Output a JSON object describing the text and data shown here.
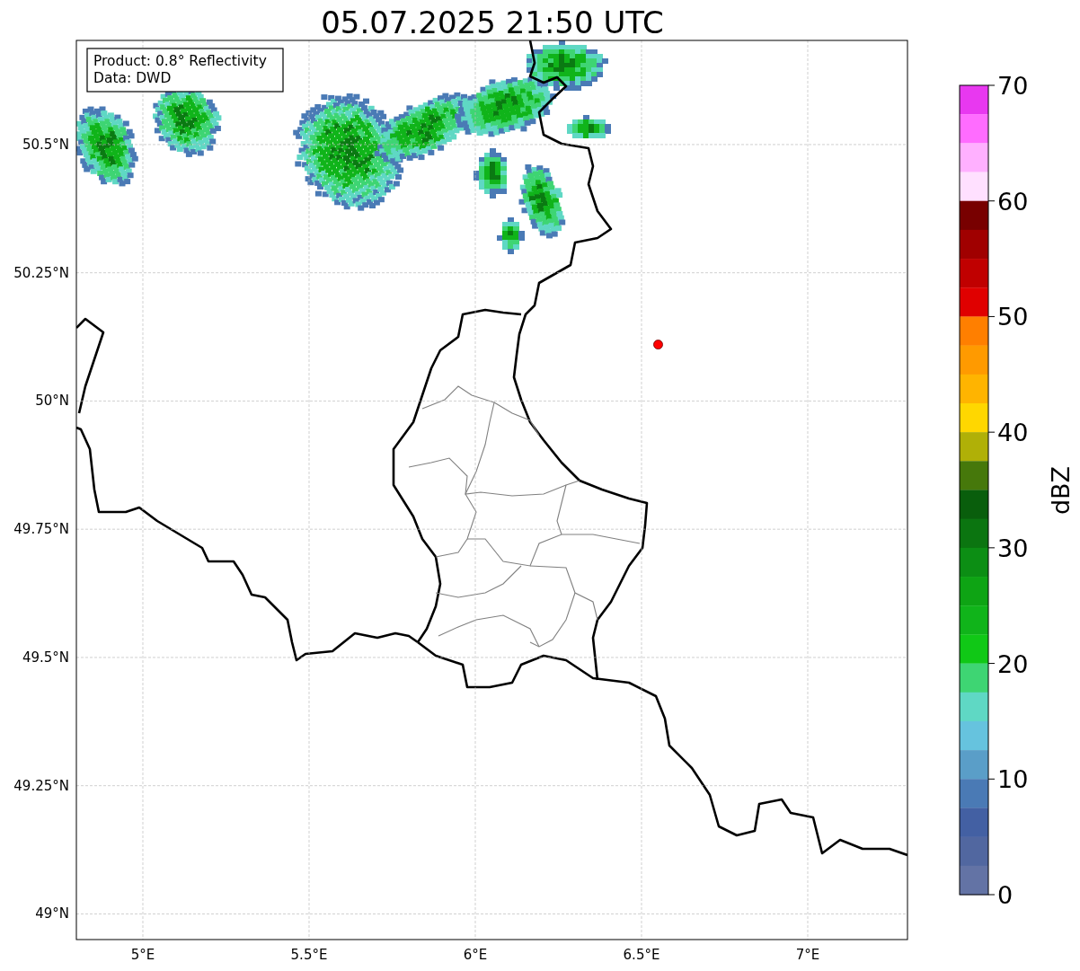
{
  "title": "05.07.2025 21:50 UTC",
  "map": {
    "info_box": [
      "Product: 0.8° Reflectivity",
      "Data: DWD"
    ],
    "chart_data": {
      "type": "scatter",
      "grid": true,
      "x": [
        6.55
      ],
      "series": [
        {
          "color": "#ff0000",
          "values": [
            50.11
          ]
        }
      ],
      "xlim": [
        4.8,
        7.3
      ],
      "ylim": [
        48.95,
        50.703
      ],
      "xticks": [
        {
          "value": 5,
          "label": "5°E"
        },
        {
          "value": 5.5,
          "label": "5.5°E"
        },
        {
          "value": 6,
          "label": "6°E"
        },
        {
          "value": 6.5,
          "label": "6.5°E"
        },
        {
          "value": 7,
          "label": "7°E"
        }
      ],
      "yticks": [
        {
          "value": 49,
          "label": "49°N"
        },
        {
          "value": 49.25,
          "label": "49.25°N"
        },
        {
          "value": 49.5,
          "label": "49.5°N"
        },
        {
          "value": 49.75,
          "label": "49.75°N"
        },
        {
          "value": 50,
          "label": "50°N"
        },
        {
          "value": 50.25,
          "label": "50.25°N"
        },
        {
          "value": 50.5,
          "label": "50.5°N"
        }
      ]
    }
  },
  "colorbar": {
    "label": "dBZ",
    "ticks": [
      "70",
      "60",
      "50",
      "40",
      "30",
      "20",
      "10",
      "0"
    ],
    "bins": [
      {
        "color": "#e838f0"
      },
      {
        "color": "#ff6cff"
      },
      {
        "color": "#ffb0ff"
      },
      {
        "color": "#ffe0ff"
      },
      {
        "color": "#780000"
      },
      {
        "color": "#a00000"
      },
      {
        "color": "#c00000"
      },
      {
        "color": "#e00000"
      },
      {
        "color": "#ff7f00"
      },
      {
        "color": "#ff9a00"
      },
      {
        "color": "#ffb400"
      },
      {
        "color": "#ffd700"
      },
      {
        "color": "#b0b007"
      },
      {
        "color": "#46780b"
      },
      {
        "color": "#095e0c"
      },
      {
        "color": "#0b7510"
      },
      {
        "color": "#0c8e14"
      },
      {
        "color": "#0ea414"
      },
      {
        "color": "#10b41a"
      },
      {
        "color": "#10c816"
      },
      {
        "color": "#3ed573"
      },
      {
        "color": "#5fd8c4"
      },
      {
        "color": "#66c3de"
      },
      {
        "color": "#5a9ec8"
      },
      {
        "color": "#4a7ab5"
      },
      {
        "color": "#4360a3"
      },
      {
        "color": "#5167a0"
      },
      {
        "color": "#6373a5"
      }
    ]
  }
}
